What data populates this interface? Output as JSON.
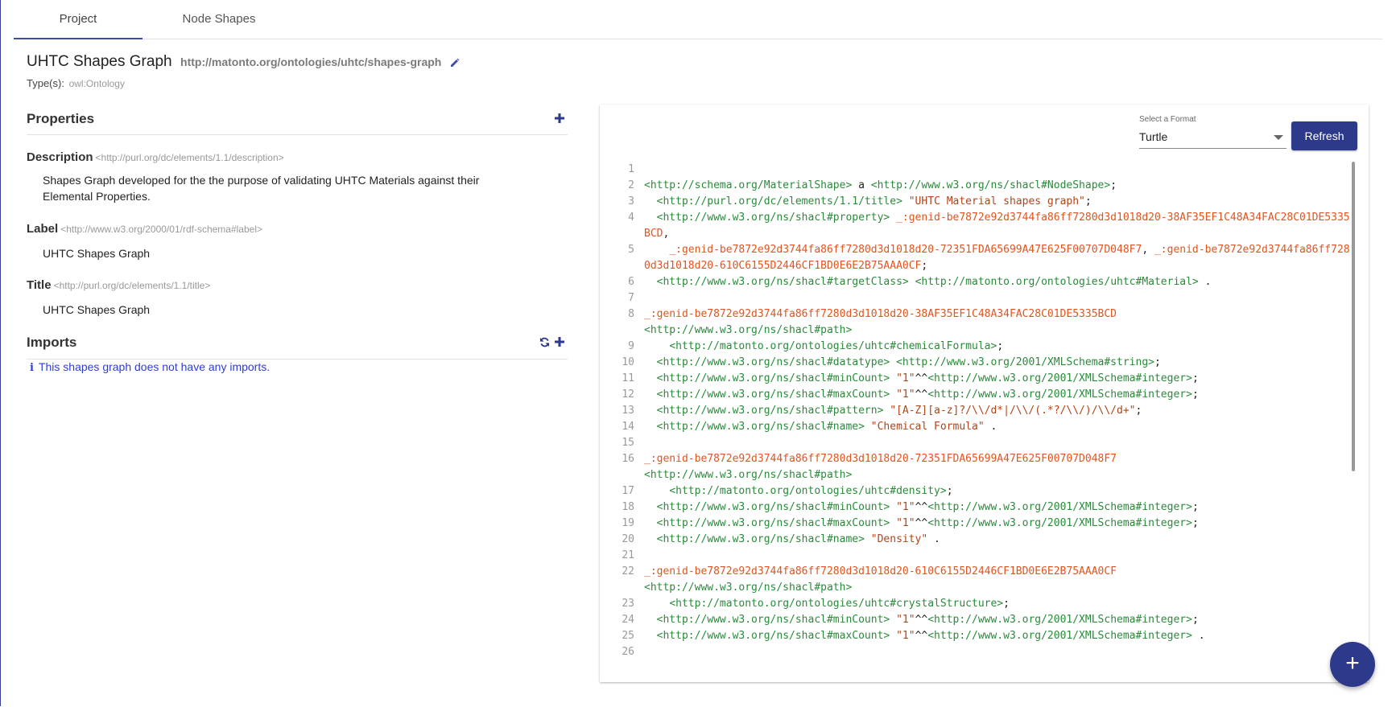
{
  "tabs": [
    {
      "label": "Project"
    },
    {
      "label": "Node Shapes"
    }
  ],
  "header": {
    "title": "UHTC Shapes Graph",
    "iri": "http://matonto.org/ontologies/uhtc/shapes-graph",
    "types_label": "Type(s):",
    "types_value": "owl:Ontology"
  },
  "properties": {
    "heading": "Properties",
    "items": [
      {
        "name": "Description",
        "iri": "<http://purl.org/dc/elements/1.1/description>",
        "value_line1": "Shapes Graph developed for the the purpose of validating UHTC Materials against their",
        "value_line2": "Elemental Properties."
      },
      {
        "name": "Label",
        "iri": "<http://www.w3.org/2000/01/rdf-schema#label>",
        "value": "UHTC Shapes Graph"
      },
      {
        "name": "Title",
        "iri": "<http://purl.org/dc/elements/1.1/title>",
        "value": "UHTC Shapes Graph"
      }
    ]
  },
  "imports": {
    "heading": "Imports",
    "empty_message": "This shapes graph does not have any imports."
  },
  "serialization": {
    "format_label": "Select a Format",
    "format_value": "Turtle",
    "refresh_label": "Refresh",
    "lines": [
      {
        "n": "1",
        "parts": []
      },
      {
        "n": "2",
        "parts": [
          [
            "u",
            "<http://schema.org/MaterialShape>"
          ],
          [
            "k",
            " a "
          ],
          [
            "u",
            "<http://www.w3.org/ns/shacl#NodeShape>"
          ],
          [
            "k",
            ";"
          ]
        ]
      },
      {
        "n": "3",
        "parts": [
          [
            "k",
            "  "
          ],
          [
            "u",
            "<http://purl.org/dc/elements/1.1/title>"
          ],
          [
            "k",
            " "
          ],
          [
            "s",
            "\"UHTC Material shapes graph\""
          ],
          [
            "k",
            ";"
          ]
        ]
      },
      {
        "n": "4",
        "parts": [
          [
            "k",
            "  "
          ],
          [
            "u",
            "<http://www.w3.org/ns/shacl#property>"
          ],
          [
            "k",
            " "
          ],
          [
            "b",
            "_:genid-be7872e92d3744fa86ff7280d3d1018d20-38AF35EF1C48A34FAC28C01DE5335BCD"
          ],
          [
            "k",
            ","
          ]
        ]
      },
      {
        "n": "5",
        "parts": [
          [
            "k",
            "    "
          ],
          [
            "b",
            "_:genid-be7872e92d3744fa86ff7280d3d1018d20-72351FDA65699A47E625F00707D048F7"
          ],
          [
            "k",
            ", "
          ],
          [
            "b",
            "_:genid-be7872e92d3744fa86ff7280d3d1018d20-610C6155D2446CF1BD0E6E2B75AAA0CF"
          ],
          [
            "k",
            ";"
          ]
        ]
      },
      {
        "n": "6",
        "parts": [
          [
            "k",
            "  "
          ],
          [
            "u",
            "<http://www.w3.org/ns/shacl#targetClass>"
          ],
          [
            "k",
            " "
          ],
          [
            "u",
            "<http://matonto.org/ontologies/uhtc#Material>"
          ],
          [
            "k",
            " ."
          ]
        ]
      },
      {
        "n": "7",
        "parts": []
      },
      {
        "n": "8",
        "parts": [
          [
            "b",
            "_:genid-be7872e92d3744fa86ff7280d3d1018d20-38AF35EF1C48A34FAC28C01DE5335BCD"
          ],
          [
            "k",
            "\n"
          ],
          [
            "u",
            "<http://www.w3.org/ns/shacl#path>"
          ]
        ]
      },
      {
        "n": "9",
        "parts": [
          [
            "k",
            "    "
          ],
          [
            "u",
            "<http://matonto.org/ontologies/uhtc#chemicalFormula>"
          ],
          [
            "k",
            ";"
          ]
        ]
      },
      {
        "n": "10",
        "parts": [
          [
            "k",
            "  "
          ],
          [
            "u",
            "<http://www.w3.org/ns/shacl#datatype>"
          ],
          [
            "k",
            " "
          ],
          [
            "u",
            "<http://www.w3.org/2001/XMLSchema#string>"
          ],
          [
            "k",
            ";"
          ]
        ]
      },
      {
        "n": "11",
        "parts": [
          [
            "k",
            "  "
          ],
          [
            "u",
            "<http://www.w3.org/ns/shacl#minCount>"
          ],
          [
            "k",
            " "
          ],
          [
            "s",
            "\"1\""
          ],
          [
            "k",
            "^^"
          ],
          [
            "u",
            "<http://www.w3.org/2001/XMLSchema#integer>"
          ],
          [
            "k",
            ";"
          ]
        ]
      },
      {
        "n": "12",
        "parts": [
          [
            "k",
            "  "
          ],
          [
            "u",
            "<http://www.w3.org/ns/shacl#maxCount>"
          ],
          [
            "k",
            " "
          ],
          [
            "s",
            "\"1\""
          ],
          [
            "k",
            "^^"
          ],
          [
            "u",
            "<http://www.w3.org/2001/XMLSchema#integer>"
          ],
          [
            "k",
            ";"
          ]
        ]
      },
      {
        "n": "13",
        "parts": [
          [
            "k",
            "  "
          ],
          [
            "u",
            "<http://www.w3.org/ns/shacl#pattern>"
          ],
          [
            "k",
            " "
          ],
          [
            "s",
            "\"[A-Z][a-z]?/\\\\/d*|/\\\\/(.*?/\\\\/)/\\\\/d+\""
          ],
          [
            "k",
            ";"
          ]
        ]
      },
      {
        "n": "14",
        "parts": [
          [
            "k",
            "  "
          ],
          [
            "u",
            "<http://www.w3.org/ns/shacl#name>"
          ],
          [
            "k",
            " "
          ],
          [
            "s",
            "\"Chemical Formula\""
          ],
          [
            "k",
            " ."
          ]
        ]
      },
      {
        "n": "15",
        "parts": []
      },
      {
        "n": "16",
        "parts": [
          [
            "b",
            "_:genid-be7872e92d3744fa86ff7280d3d1018d20-72351FDA65699A47E625F00707D048F7"
          ],
          [
            "k",
            "\n"
          ],
          [
            "u",
            "<http://www.w3.org/ns/shacl#path>"
          ]
        ]
      },
      {
        "n": "17",
        "parts": [
          [
            "k",
            "    "
          ],
          [
            "u",
            "<http://matonto.org/ontologies/uhtc#density>"
          ],
          [
            "k",
            ";"
          ]
        ]
      },
      {
        "n": "18",
        "parts": [
          [
            "k",
            "  "
          ],
          [
            "u",
            "<http://www.w3.org/ns/shacl#minCount>"
          ],
          [
            "k",
            " "
          ],
          [
            "s",
            "\"1\""
          ],
          [
            "k",
            "^^"
          ],
          [
            "u",
            "<http://www.w3.org/2001/XMLSchema#integer>"
          ],
          [
            "k",
            ";"
          ]
        ]
      },
      {
        "n": "19",
        "parts": [
          [
            "k",
            "  "
          ],
          [
            "u",
            "<http://www.w3.org/ns/shacl#maxCount>"
          ],
          [
            "k",
            " "
          ],
          [
            "s",
            "\"1\""
          ],
          [
            "k",
            "^^"
          ],
          [
            "u",
            "<http://www.w3.org/2001/XMLSchema#integer>"
          ],
          [
            "k",
            ";"
          ]
        ]
      },
      {
        "n": "20",
        "parts": [
          [
            "k",
            "  "
          ],
          [
            "u",
            "<http://www.w3.org/ns/shacl#name>"
          ],
          [
            "k",
            " "
          ],
          [
            "s",
            "\"Density\""
          ],
          [
            "k",
            " ."
          ]
        ]
      },
      {
        "n": "21",
        "parts": []
      },
      {
        "n": "22",
        "parts": [
          [
            "b",
            "_:genid-be7872e92d3744fa86ff7280d3d1018d20-610C6155D2446CF1BD0E6E2B75AAA0CF"
          ],
          [
            "k",
            "\n"
          ],
          [
            "u",
            "<http://www.w3.org/ns/shacl#path>"
          ]
        ]
      },
      {
        "n": "23",
        "parts": [
          [
            "k",
            "    "
          ],
          [
            "u",
            "<http://matonto.org/ontologies/uhtc#crystalStructure>"
          ],
          [
            "k",
            ";"
          ]
        ]
      },
      {
        "n": "24",
        "parts": [
          [
            "k",
            "  "
          ],
          [
            "u",
            "<http://www.w3.org/ns/shacl#minCount>"
          ],
          [
            "k",
            " "
          ],
          [
            "s",
            "\"1\""
          ],
          [
            "k",
            "^^"
          ],
          [
            "u",
            "<http://www.w3.org/2001/XMLSchema#integer>"
          ],
          [
            "k",
            ";"
          ]
        ]
      },
      {
        "n": "25",
        "parts": [
          [
            "k",
            "  "
          ],
          [
            "u",
            "<http://www.w3.org/ns/shacl#maxCount>"
          ],
          [
            "k",
            " "
          ],
          [
            "s",
            "\"1\""
          ],
          [
            "k",
            "^^"
          ],
          [
            "u",
            "<http://www.w3.org/2001/XMLSchema#integer>"
          ],
          [
            "k",
            " ."
          ]
        ]
      },
      {
        "n": "26",
        "parts": []
      }
    ]
  },
  "fab": {
    "label": "+"
  }
}
